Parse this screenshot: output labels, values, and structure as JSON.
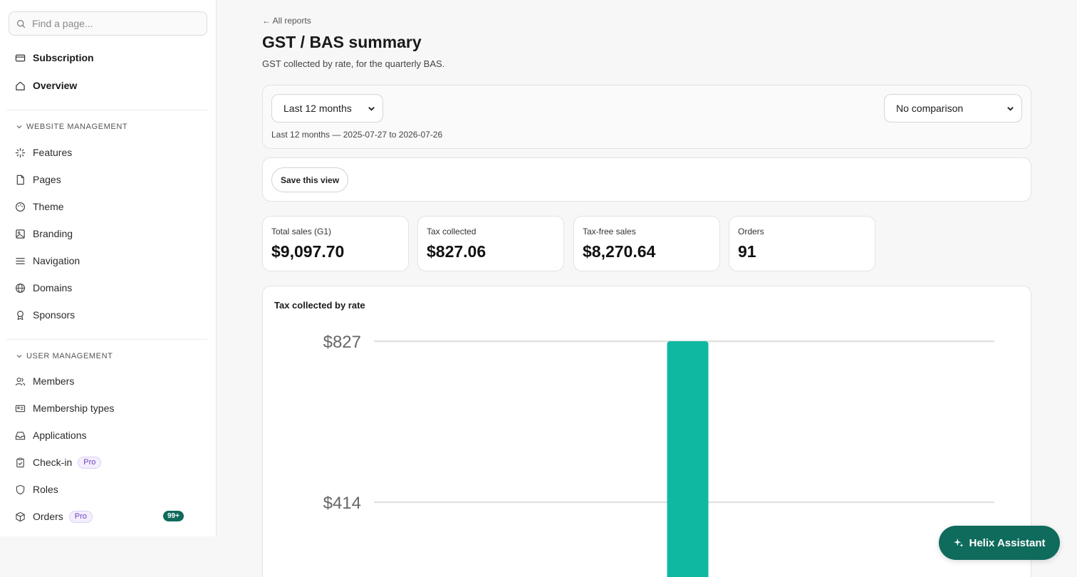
{
  "sidebar": {
    "search_placeholder": "Find a page...",
    "top_items": [
      {
        "label": "Subscription",
        "icon": "card-icon"
      },
      {
        "label": "Overview",
        "icon": "home-icon"
      }
    ],
    "sections": [
      {
        "title": "WEBSITE MANAGEMENT",
        "items": [
          {
            "label": "Features",
            "icon": "sparkle-icon"
          },
          {
            "label": "Pages",
            "icon": "page-icon"
          },
          {
            "label": "Theme",
            "icon": "palette-icon"
          },
          {
            "label": "Branding",
            "icon": "image-icon"
          },
          {
            "label": "Navigation",
            "icon": "menu-icon"
          },
          {
            "label": "Domains",
            "icon": "globe-icon"
          },
          {
            "label": "Sponsors",
            "icon": "award-icon"
          }
        ]
      },
      {
        "title": "USER MANAGEMENT",
        "items": [
          {
            "label": "Members",
            "icon": "users-icon"
          },
          {
            "label": "Membership types",
            "icon": "id-card-icon"
          },
          {
            "label": "Applications",
            "icon": "inbox-icon"
          },
          {
            "label": "Check-in",
            "icon": "clipboard-check-icon",
            "badge": "Pro"
          },
          {
            "label": "Roles",
            "icon": "shield-icon"
          },
          {
            "label": "Orders",
            "icon": "box-icon",
            "badge": "Pro",
            "count": "99+"
          }
        ]
      }
    ]
  },
  "header": {
    "back_link": "← All reports",
    "title": "GST / BAS summary",
    "subtitle": "GST collected by rate, for the quarterly BAS."
  },
  "filters": {
    "period_selected": "Last 12 months",
    "comparison_selected": "No comparison",
    "range_note": "Last 12 months — 2025-07-27 to 2026-07-26"
  },
  "save_view_label": "Save this view",
  "stats": [
    {
      "label": "Total sales (G1)",
      "value": "$9,097.70"
    },
    {
      "label": "Tax collected",
      "value": "$827.06"
    },
    {
      "label": "Tax-free sales",
      "value": "$8,270.64"
    },
    {
      "label": "Orders",
      "value": "91"
    }
  ],
  "chart_title": "Tax collected by rate",
  "chart_data": {
    "type": "bar",
    "title": "Tax collected by rate",
    "categories": [
      ""
    ],
    "values": [
      827.06
    ],
    "ylim": [
      0,
      827
    ],
    "y_ticks": [
      414,
      827
    ],
    "y_tick_labels": [
      "$414",
      "$827"
    ],
    "grid": true,
    "bar_color": "#0fb8a1"
  },
  "assistant_label": "Helix Assistant",
  "colors": {
    "accent": "#0f6b5c",
    "bar": "#0fb8a1",
    "pro_text": "#6d3fb8"
  }
}
